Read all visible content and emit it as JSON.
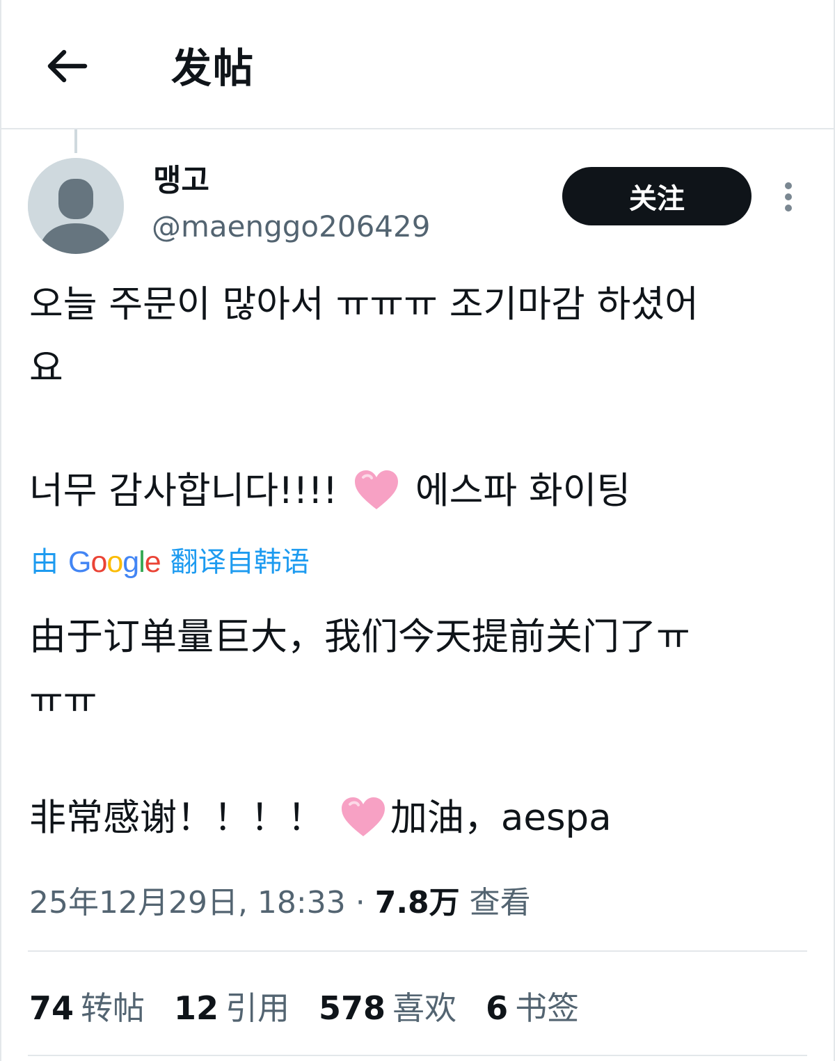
{
  "header": {
    "back_icon": "arrow-left-icon",
    "title": "发帖"
  },
  "author": {
    "avatar_icon": "default-avatar-icon",
    "name": "맹고",
    "handle": "@maenggo206429",
    "follow_label": "关注",
    "more_icon": "more-vertical-icon"
  },
  "tweet": {
    "original_line1": "오늘 주문이 많아서 ㅠㅠㅠ 조기마감 하셨어",
    "original_line2": "요",
    "original_line3_before": "너무 감사합니다!!!! ",
    "original_line3_after": " 에스파 화이팅",
    "translate_prefix": "由",
    "translate_brand": "Google",
    "translate_suffix": "翻译自韩语",
    "translated_line1": "由于订单量巨大，我们今天提前关门了ㅠ",
    "translated_line2": "ㅠㅠ",
    "translated_line3_before": "非常感谢！！！！ ",
    "translated_line3_after": "加油，aespa",
    "heart_icon": "pink-heart-icon",
    "heart_color": "#f7a1c4"
  },
  "meta": {
    "timestamp": "25年12月29日, 18:33 · ",
    "views_count": "7.8万",
    "views_label": " 查看"
  },
  "stats": {
    "reposts_count": "74",
    "reposts_label": "转帖",
    "quotes_count": "12",
    "quotes_label": "引用",
    "likes_count": "578",
    "likes_label": "喜欢",
    "bookmarks_count": "6",
    "bookmarks_label": "书签"
  },
  "colors": {
    "text": "#0f1419",
    "secondary_text": "#536471",
    "link": "#1d9bf0",
    "divider": "#e3e7ea",
    "follow_bg": "#0f1419"
  }
}
